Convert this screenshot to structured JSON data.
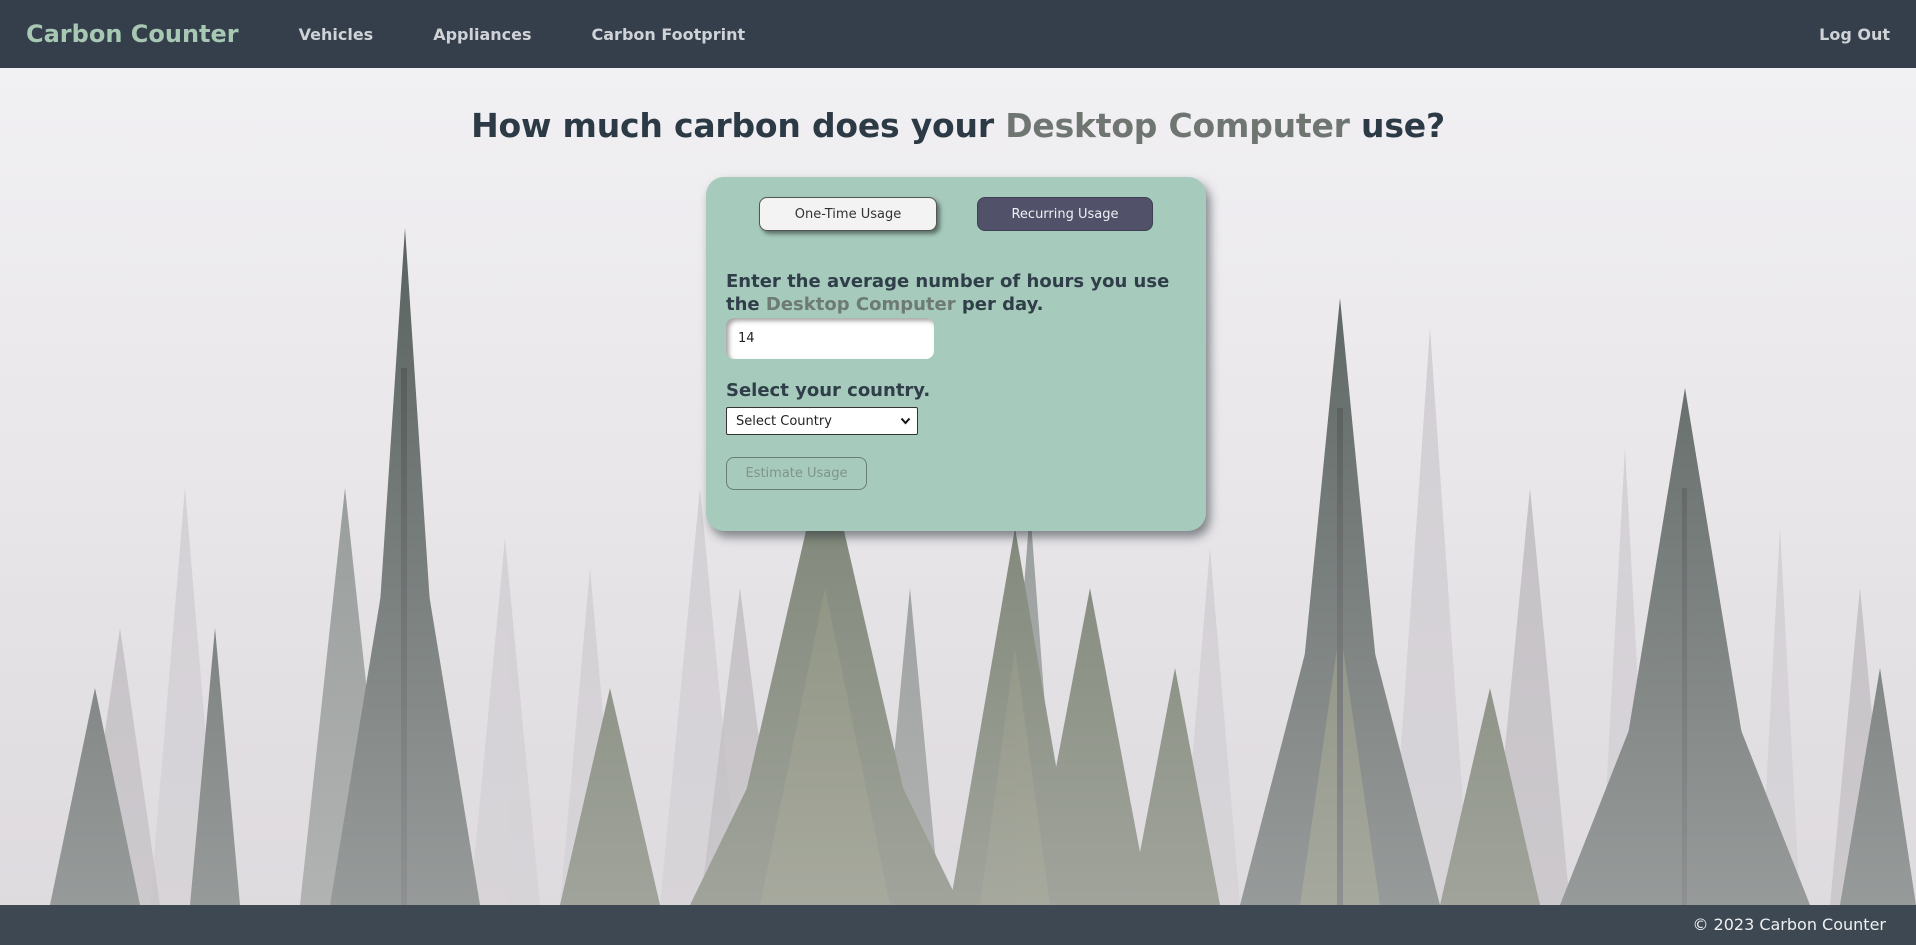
{
  "nav": {
    "brand": "Carbon Counter",
    "links": [
      "Vehicles",
      "Appliances",
      "Carbon Footprint"
    ],
    "logout": "Log Out"
  },
  "headline": {
    "prefix": "How much carbon does your ",
    "appliance": "Desktop Computer",
    "suffix": " use?"
  },
  "card": {
    "tabs": {
      "one_time": "One-Time Usage",
      "recurring": "Recurring Usage",
      "active": "recurring"
    },
    "prompt": {
      "prefix": "Enter the average number of hours you use the ",
      "appliance": "Desktop Computer",
      "suffix": " per day."
    },
    "hours_value": "14",
    "country_label": "Select your country.",
    "country_selected": "Select Country",
    "estimate_label": "Estimate Usage",
    "estimate_disabled": true
  },
  "footer": {
    "copyright": "© 2023 Carbon Counter"
  },
  "colors": {
    "navbar": "#353f4b",
    "brand": "#a7c8b3",
    "card": "#a6cabb",
    "active_tab": "#515269",
    "accent_text": "#6f7672"
  },
  "icons": {
    "select_chevron": "chevron-down-icon"
  }
}
